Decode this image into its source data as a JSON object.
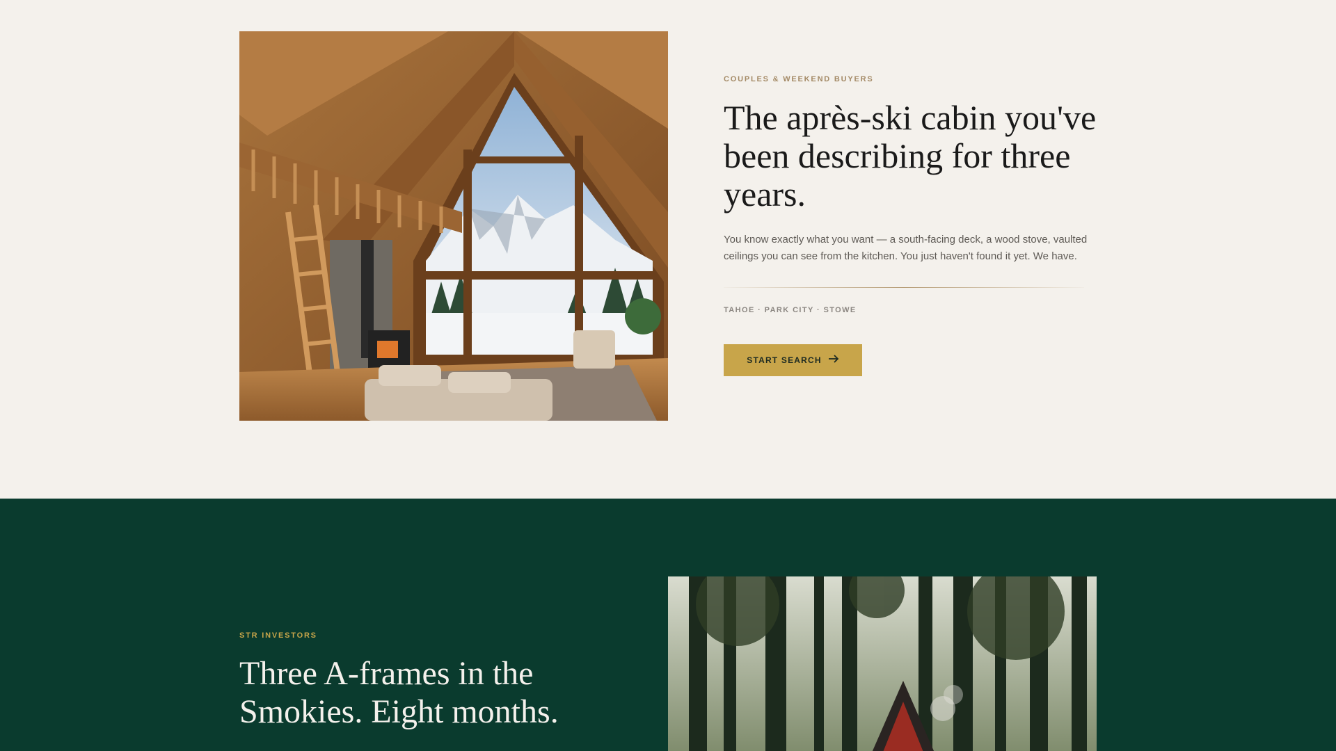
{
  "section1": {
    "image_alt": "Cabin interior with vaulted ceilings and mountain view",
    "eyebrow": "COUPLES & WEEKEND BUYERS",
    "headline": "The après-ski cabin you've been describing for three years.",
    "body": "You know exactly what you want — a south-facing deck, a wood stove, vaulted ceilings you can see from the kitchen. You just haven't found it yet. We have.",
    "locations": "TAHOE · PARK CITY · STOWE",
    "cta_label": "START SEARCH",
    "cta_icon": "arrow-right-icon"
  },
  "section2": {
    "eyebrow": "STR INVESTORS",
    "headline": "Three A-frames in the Smokies. Eight months.",
    "image_alt": "Red A-frame cabin in a forest"
  },
  "colors": {
    "page_bg": "#f4f1ec",
    "dark_section_bg": "#0a3b2e",
    "accent_gold": "#c8a54a",
    "eyebrow_tan": "#a48a66",
    "headline_dark": "#1a1a1a",
    "headline_light": "#f4f1ec"
  }
}
